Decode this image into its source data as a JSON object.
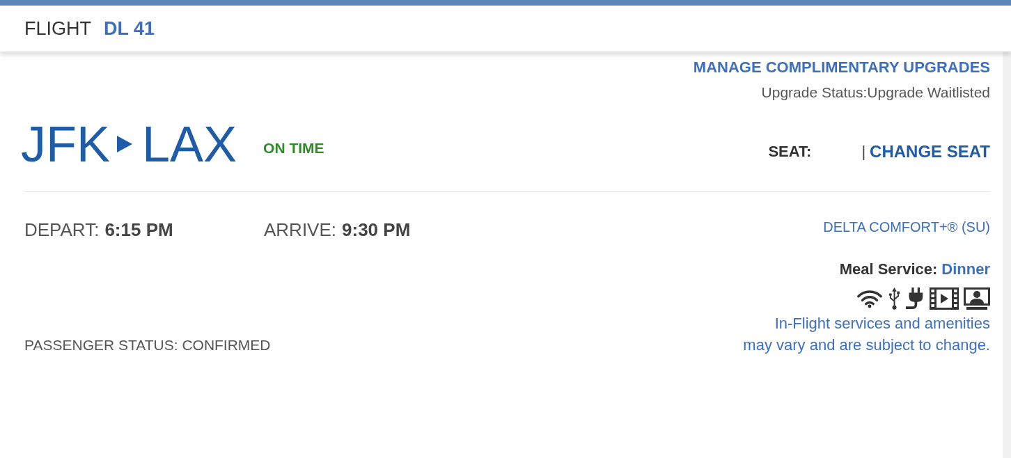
{
  "header": {
    "label": "FLIGHT",
    "flight_number": "DL 41"
  },
  "upgrades": {
    "link": "MANAGE COMPLIMENTARY UPGRADES",
    "status": "Upgrade Status:Upgrade Waitlisted"
  },
  "route": {
    "origin": "JFK",
    "destination": "LAX",
    "flight_status": "ON TIME"
  },
  "seat": {
    "label": "SEAT:",
    "separator": "|",
    "link": "CHANGE SEAT"
  },
  "times": [
    {
      "label": "DEPART:",
      "value": "6:15 PM"
    },
    {
      "label": "ARRIVE:",
      "value": "9:30 PM"
    }
  ],
  "passenger_status": "PASSENGER STATUS: CONFIRMED",
  "cabin": "DELTA COMFORT+® (SU)",
  "meal": {
    "label": "Meal Service:",
    "value": "Dinner"
  },
  "notice": {
    "lines": [
      "In-Flight services and amenities",
      "may vary and are subject to change."
    ]
  }
}
